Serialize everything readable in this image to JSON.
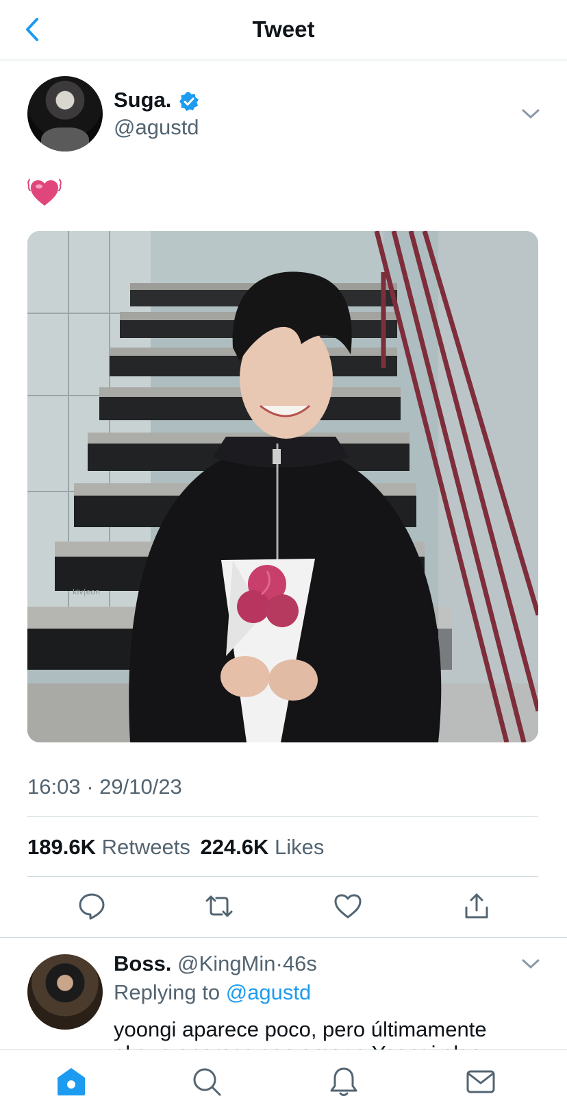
{
  "header": {
    "title": "Tweet"
  },
  "tweet": {
    "author_name": "Suga.",
    "author_handle": "@agustd",
    "text_emoji": "beating-heart-emoji",
    "timestamp": "16:03 · 29/10/23",
    "stats": {
      "retweets_count": "189.6K",
      "retweets_label": "Retweets",
      "likes_count": "224.6K",
      "likes_label": "Likes"
    },
    "media_watermark": "kiv|eon"
  },
  "actions": [
    "reply-icon",
    "retweet-icon",
    "like-icon",
    "share-icon"
  ],
  "reply": {
    "author_name": "Boss.",
    "author_handle": "@KingMin",
    "time_ago": "46s",
    "replying_prefix": "Replying to",
    "replying_to": "@agustd",
    "text": "yoongi aparece poco, pero últimamente",
    "text_line2": "el que aparece con amor a Yoongi algo"
  },
  "tabbar": [
    "home-icon",
    "search-icon",
    "notifications-icon",
    "messages-icon"
  ],
  "colors": {
    "accent": "#1d9bf0",
    "text": "#0f1419",
    "secondary": "#536471",
    "divider": "#cfd9de",
    "heart": "#e0457b"
  }
}
